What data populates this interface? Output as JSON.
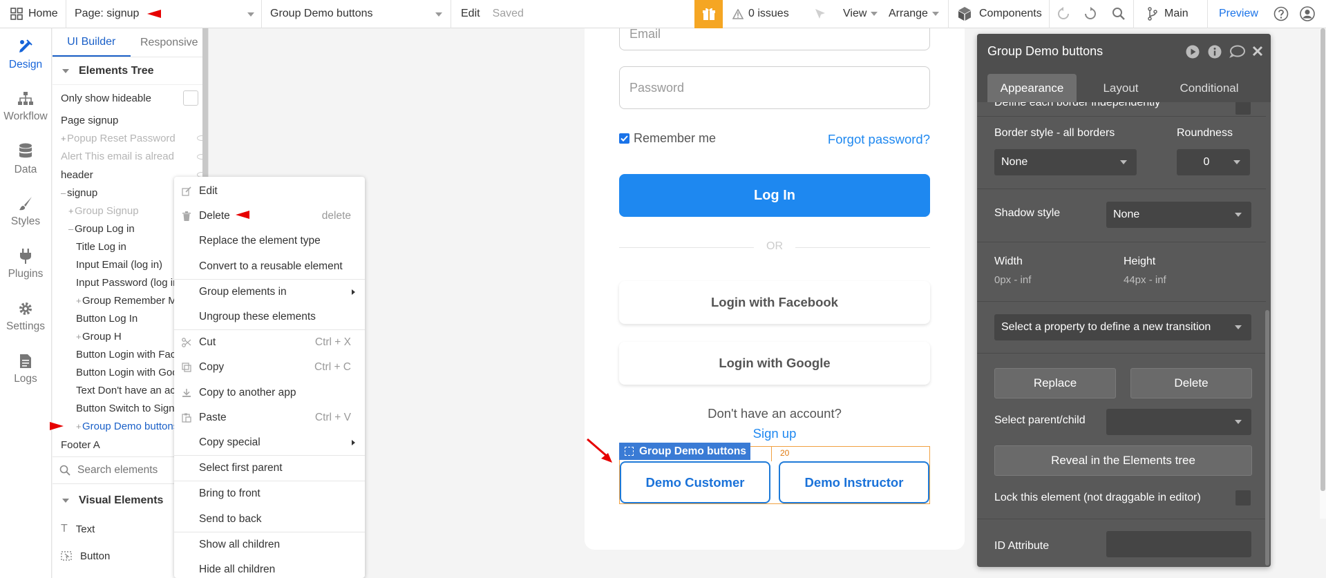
{
  "topbar": {
    "home": "Home",
    "page": "Page: signup",
    "element": "Group Demo buttons",
    "edit": "Edit",
    "saved": "Saved",
    "issues": "0 issues",
    "view": "View",
    "arrange": "Arrange",
    "components": "Components",
    "branch": "Main",
    "preview": "Preview",
    "icons": [
      "grid-icon",
      "gift-icon",
      "warning-icon",
      "cursor-icon",
      "cube-icon",
      "undo-icon",
      "redo-icon",
      "search-icon",
      "branch-icon",
      "help-icon",
      "user-icon"
    ]
  },
  "rail": [
    {
      "label": "Design",
      "icon": "design-icon"
    },
    {
      "label": "Workflow",
      "icon": "workflow-icon"
    },
    {
      "label": "Data",
      "icon": "database-icon"
    },
    {
      "label": "Styles",
      "icon": "brush-icon"
    },
    {
      "label": "Plugins",
      "icon": "plug-icon"
    },
    {
      "label": "Settings",
      "icon": "gear-icon"
    },
    {
      "label": "Logs",
      "icon": "document-icon"
    }
  ],
  "panel": {
    "tabs": [
      "UI Builder",
      "Responsive"
    ],
    "tree_title": "Elements Tree",
    "only_hideable": "Only show hideable",
    "items": [
      {
        "label": "Page signup",
        "indent": 0,
        "prefix": "",
        "style": ""
      },
      {
        "label": "Popup Reset Password",
        "indent": 0,
        "prefix": "+",
        "style": "faded"
      },
      {
        "label": "Alert This email is alread",
        "indent": 0,
        "prefix": "",
        "style": "faded"
      },
      {
        "label": "header",
        "indent": 0,
        "prefix": "",
        "style": ""
      },
      {
        "label": "signup",
        "indent": 0,
        "prefix": "–",
        "style": ""
      },
      {
        "label": "Group Signup",
        "indent": 1,
        "prefix": "+",
        "style": "faded"
      },
      {
        "label": "Group Log in",
        "indent": 1,
        "prefix": "–",
        "style": ""
      },
      {
        "label": "Title Log in",
        "indent": 2,
        "prefix": "",
        "style": ""
      },
      {
        "label": "Input Email (log in)",
        "indent": 2,
        "prefix": "",
        "style": ""
      },
      {
        "label": "Input Password (log in",
        "indent": 2,
        "prefix": "",
        "style": ""
      },
      {
        "label": "Group Remember Me",
        "indent": 2,
        "prefix": "+",
        "style": ""
      },
      {
        "label": "Button Log In",
        "indent": 2,
        "prefix": "",
        "style": ""
      },
      {
        "label": "Group H",
        "indent": 2,
        "prefix": "+",
        "style": ""
      },
      {
        "label": "Button Login with Face",
        "indent": 2,
        "prefix": "",
        "style": ""
      },
      {
        "label": "Button Login with Goo",
        "indent": 2,
        "prefix": "",
        "style": ""
      },
      {
        "label": "Text Don't have an acc",
        "indent": 2,
        "prefix": "",
        "style": ""
      },
      {
        "label": "Button Switch to Sign u",
        "indent": 2,
        "prefix": "",
        "style": ""
      },
      {
        "label": "Group Demo buttons",
        "indent": 2,
        "prefix": "+",
        "style": "sel"
      },
      {
        "label": "Footer A",
        "indent": 0,
        "prefix": "",
        "style": ""
      }
    ],
    "search_placeholder": "Search elements",
    "visual_title": "Visual Elements",
    "visual_items": [
      {
        "label": "Text",
        "icon": "text-icon"
      },
      {
        "label": "Button",
        "icon": "button-icon"
      }
    ]
  },
  "context_menu": [
    {
      "label": "Edit",
      "shortcut": "",
      "icon": "edit-icon",
      "sub": false,
      "divider": false
    },
    {
      "label": "Delete",
      "shortcut": "delete",
      "icon": "trash-icon",
      "sub": false,
      "divider": false
    },
    {
      "label": "Replace the element type",
      "shortcut": "",
      "icon": "",
      "sub": false,
      "divider": false
    },
    {
      "label": "Convert to a reusable element",
      "shortcut": "",
      "icon": "",
      "sub": false,
      "divider": true
    },
    {
      "label": "Group elements in",
      "shortcut": "",
      "icon": "",
      "sub": true,
      "divider": false
    },
    {
      "label": "Ungroup these elements",
      "shortcut": "",
      "icon": "",
      "sub": false,
      "divider": true
    },
    {
      "label": "Cut",
      "shortcut": "Ctrl + X",
      "icon": "scissors-icon",
      "sub": false,
      "divider": false
    },
    {
      "label": "Copy",
      "shortcut": "Ctrl + C",
      "icon": "copy-icon",
      "sub": false,
      "divider": false
    },
    {
      "label": "Copy to another app",
      "shortcut": "",
      "icon": "download-icon",
      "sub": false,
      "divider": false
    },
    {
      "label": "Paste",
      "shortcut": "Ctrl + V",
      "icon": "paste-icon",
      "sub": false,
      "divider": false
    },
    {
      "label": "Copy special",
      "shortcut": "",
      "icon": "",
      "sub": true,
      "divider": true
    },
    {
      "label": "Select first parent",
      "shortcut": "",
      "icon": "",
      "sub": false,
      "divider": true
    },
    {
      "label": "Bring to front",
      "shortcut": "",
      "icon": "",
      "sub": false,
      "divider": false
    },
    {
      "label": "Send to back",
      "shortcut": "",
      "icon": "",
      "sub": false,
      "divider": true
    },
    {
      "label": "Show all children",
      "shortcut": "",
      "icon": "",
      "sub": false,
      "divider": false
    },
    {
      "label": "Hide all children",
      "shortcut": "",
      "icon": "",
      "sub": false,
      "divider": false
    }
  ],
  "canvas": {
    "email_placeholder": "Email",
    "password_placeholder": "Password",
    "remember": "Remember me",
    "forgot": "Forgot password?",
    "login": "Log In",
    "or": "OR",
    "facebook": "Login with Facebook",
    "google": "Login with Google",
    "no_account": "Don't have an account?",
    "signup": "Sign up",
    "group_tag": "Group Demo buttons",
    "spacing_value": "20",
    "demo_customer": "Demo Customer",
    "demo_instructor": "Demo Instructor",
    "colors": {
      "primary": "#1e88f0",
      "selection": "#3a7bd5",
      "annotation": "#e60000"
    }
  },
  "property_panel": {
    "title": "Group Demo buttons",
    "header_icons": [
      "play-icon",
      "info-icon",
      "comment-icon",
      "close-icon"
    ],
    "tabs": [
      "Appearance",
      "Layout",
      "Conditional"
    ],
    "border_independent": "Define each border independently",
    "border_style_label": "Border style - all borders",
    "border_style_value": "None",
    "roundness_label": "Roundness",
    "roundness_value": "0",
    "shadow_label": "Shadow style",
    "shadow_value": "None",
    "width_label": "Width",
    "width_value": "0px - inf",
    "height_label": "Height",
    "height_value": "44px - inf",
    "transition_placeholder": "Select a property to define a new transition",
    "replace": "Replace",
    "delete": "Delete",
    "parent_child_label": "Select parent/child",
    "reveal": "Reveal in the Elements tree",
    "lock_label": "Lock this element (not draggable in editor)",
    "id_label": "ID Attribute"
  }
}
